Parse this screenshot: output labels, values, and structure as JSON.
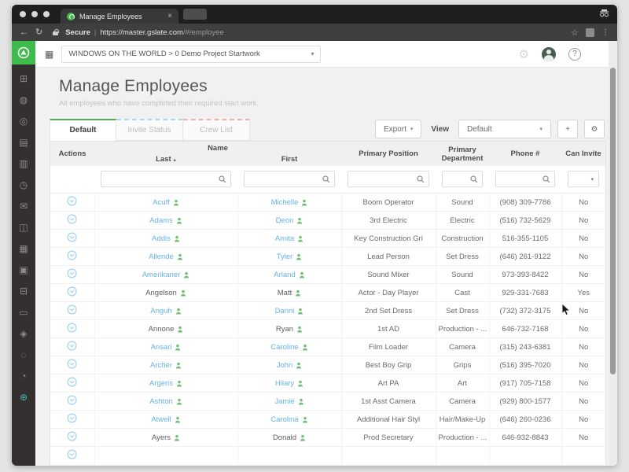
{
  "browser": {
    "tab_title": "Manage Employees",
    "close_tab": "×",
    "secure_label": "Secure",
    "url_domain": "https://master.gslate.com",
    "url_path": "/#/employee",
    "back_icon": "←",
    "refresh_icon": "↻",
    "star_icon": "☆",
    "menu_icon": "⋮"
  },
  "app_header": {
    "project_selector": "WINDOWS ON THE WORLD > 0 Demo Project Startwork",
    "caret": "▾",
    "help_label": "?"
  },
  "sidebar": {
    "icons": [
      {
        "name": "dashboard",
        "glyph": "⊞"
      },
      {
        "name": "world",
        "glyph": "◍"
      },
      {
        "name": "projects",
        "glyph": "◎"
      },
      {
        "name": "documents",
        "glyph": "▤"
      },
      {
        "name": "files",
        "glyph": "▥"
      },
      {
        "name": "clock",
        "glyph": "◷"
      },
      {
        "name": "mail",
        "glyph": "✉"
      },
      {
        "name": "people",
        "glyph": "◫"
      },
      {
        "name": "calendar",
        "glyph": "▦"
      },
      {
        "name": "reports",
        "glyph": "▣"
      },
      {
        "name": "printer",
        "glyph": "⊟"
      },
      {
        "name": "chat",
        "glyph": "▭"
      },
      {
        "name": "payroll",
        "glyph": "◈"
      },
      {
        "name": "media",
        "glyph": "◌"
      },
      {
        "name": "history",
        "glyph": "◔"
      },
      {
        "name": "add-person",
        "glyph": "⊕",
        "color": "#4db6ac"
      }
    ]
  },
  "page": {
    "title": "Manage Employees",
    "subtitle": "All employees who have completed their required start work."
  },
  "tabs": [
    {
      "label": "Default",
      "active": true,
      "accent": "#4cae50"
    },
    {
      "label": "Invite Status",
      "active": false,
      "accent": "#a5d9f0"
    },
    {
      "label": "Crew List",
      "active": false,
      "accent": "#f4b0a5"
    }
  ],
  "toolbar": {
    "export_label": "Export",
    "view_label": "View",
    "view_value": "Default",
    "add_label": "+",
    "caret": "▾"
  },
  "table": {
    "headers": {
      "actions": "Actions",
      "name_group": "Name",
      "last": "Last",
      "sort_caret": "▴",
      "first": "First",
      "position": "Primary Position",
      "department": "Primary Department",
      "phone": "Phone #",
      "can_invite": "Can Invite"
    },
    "sort": {
      "column": "last",
      "direction": "asc"
    },
    "rows": [
      {
        "last": "Acuff",
        "first": "Michelle",
        "linked": true,
        "position": "Boom Operator",
        "department": "Sound",
        "phone": "(908) 309-7786",
        "can_invite": "No"
      },
      {
        "last": "Adams",
        "first": "Deon",
        "linked": true,
        "position": "3rd Electric",
        "department": "Electric",
        "phone": "(516) 732-5629",
        "can_invite": "No"
      },
      {
        "last": "Addis",
        "first": "Amita",
        "linked": true,
        "position": "Key Construction Gri",
        "department": "Construction",
        "phone": "516-355-1105",
        "can_invite": "No"
      },
      {
        "last": "Allende",
        "first": "Tyler",
        "linked": true,
        "position": "Lead Person",
        "department": "Set Dress",
        "phone": "(646) 261-9122",
        "can_invite": "No"
      },
      {
        "last": "Amerikaner",
        "first": "Arland",
        "linked": true,
        "position": "Sound Mixer",
        "department": "Sound",
        "phone": "973-393-8422",
        "can_invite": "No"
      },
      {
        "last": "Angelson",
        "first": "Matt",
        "linked": false,
        "position": "Actor - Day Player",
        "department": "Cast",
        "phone": "929-331-7683",
        "can_invite": "Yes"
      },
      {
        "last": "Anguh",
        "first": "Danni",
        "linked": true,
        "position": "2nd Set Dress",
        "department": "Set Dress",
        "phone": "(732) 372-3175",
        "can_invite": "No"
      },
      {
        "last": "Annone",
        "first": "Ryan",
        "linked": false,
        "position": "1st AD",
        "department": "Production - ...",
        "phone": "646-732-7168",
        "can_invite": "No"
      },
      {
        "last": "Ansari",
        "first": "Caroline",
        "linked": true,
        "position": "Film Loader",
        "department": "Camera",
        "phone": "(315) 243-6381",
        "can_invite": "No"
      },
      {
        "last": "Archer",
        "first": "John",
        "linked": true,
        "position": "Best Boy Grip",
        "department": "Grips",
        "phone": "(516) 395-7020",
        "can_invite": "No"
      },
      {
        "last": "Argeris",
        "first": "Hilary",
        "linked": true,
        "position": "Art PA",
        "department": "Art",
        "phone": "(917) 705-7158",
        "can_invite": "No"
      },
      {
        "last": "Ashton",
        "first": "Jamie",
        "linked": true,
        "position": "1st Asst Camera",
        "department": "Camera",
        "phone": "(929) 800-1577",
        "can_invite": "No"
      },
      {
        "last": "Atwell",
        "first": "Carolina",
        "linked": true,
        "position": "Additional Hair Styl",
        "department": "Hair/Make-Up",
        "phone": "(646) 260-0236",
        "can_invite": "No"
      },
      {
        "last": "Ayers",
        "first": "Donald",
        "linked": false,
        "position": "Prod Secretary",
        "department": "Production - ...",
        "phone": "646-932-8843",
        "can_invite": "No"
      }
    ],
    "partial_row_visible": true
  },
  "colors": {
    "brand_green": "#3dbb4b",
    "active_tab_accent": "#4cae50",
    "invite_tab_accent": "#a5d9f0",
    "crew_tab_accent": "#f4b0a5",
    "link_blue": "#64b3e4",
    "person_icon_green": "#6fbf73",
    "action_icon_blue": "#9fd3f2"
  }
}
